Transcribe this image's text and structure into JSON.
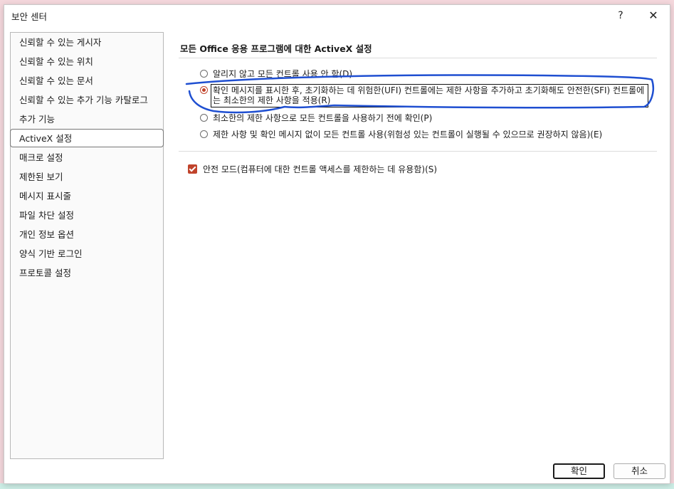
{
  "window": {
    "title": "보안 센터",
    "help_glyph": "?",
    "close_glyph": "✕"
  },
  "sidebar": {
    "items": [
      {
        "label": "신뢰할 수 있는 게시자"
      },
      {
        "label": "신뢰할 수 있는 위치"
      },
      {
        "label": "신뢰할 수 있는 문서"
      },
      {
        "label": "신뢰할 수 있는 추가 기능 카탈로그"
      },
      {
        "label": "추가 기능"
      },
      {
        "label": "ActiveX 설정",
        "selected": true
      },
      {
        "label": "매크로 설정"
      },
      {
        "label": "제한된 보기"
      },
      {
        "label": "메시지 표시줄"
      },
      {
        "label": "파일 차단 설정"
      },
      {
        "label": "개인 정보 옵션"
      },
      {
        "label": "양식 기반 로그인"
      },
      {
        "label": "프로토콜 설정"
      }
    ]
  },
  "main": {
    "section_title": "모든 Office 응용 프로그램에 대한 ActiveX 설정",
    "options": [
      {
        "label": "알리지 않고 모든 컨트롤 사용 안 함(D)",
        "checked": false
      },
      {
        "label": "확인 메시지를 표시한 후, 초기화하는 데 위험한(UFI) 컨트롤에는 제한 사항을 추가하고 초기화해도 안전한(SFI) 컨트롤에는 최소한의 제한 사항을 적용(R)",
        "checked": true
      },
      {
        "label": "최소한의 제한 사항으로 모든 컨트롤을 사용하기 전에 확인(P)",
        "checked": false
      },
      {
        "label": "제한 사항 및 확인 메시지 없이 모든 컨트롤 사용(위험성 있는 컨트롤이 실행될 수 있으므로 권장하지 않음)(E)",
        "checked": false
      }
    ],
    "safe_mode": {
      "label": "안전 모드(컴퓨터에 대한 컨트롤 액세스를 제한하는 데 유용함)(S)",
      "checked": true
    }
  },
  "footer": {
    "ok_label": "확인",
    "cancel_label": "취소"
  },
  "colors": {
    "accent": "#c0432b",
    "annotation_stroke": "#1f4fd1"
  }
}
